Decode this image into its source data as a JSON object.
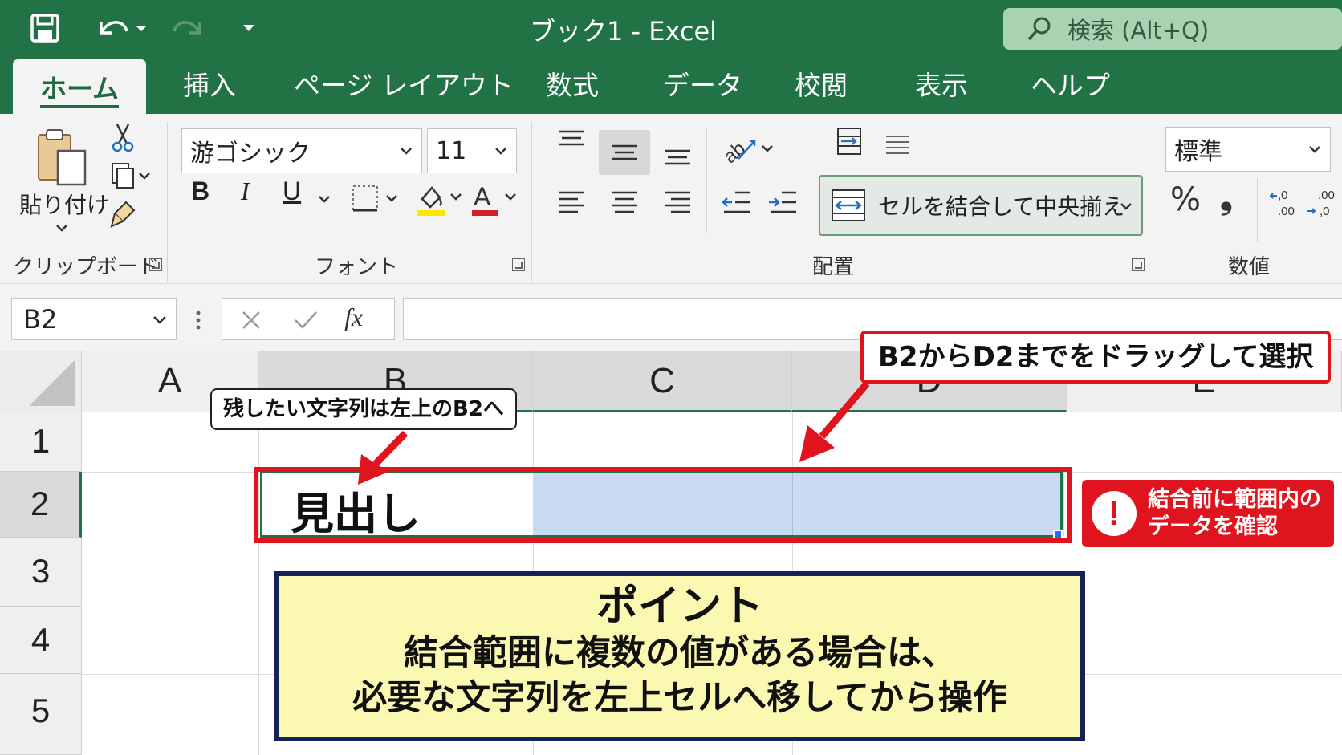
{
  "window": {
    "title": "ブック1  -  Excel",
    "search_label": "検索 (Alt+Q)"
  },
  "tabs": [
    "ホーム",
    "挿入",
    "ページ レイアウト",
    "数式",
    "データ",
    "校閲",
    "表示",
    "ヘルプ"
  ],
  "active_tab": "ホーム",
  "ribbon": {
    "clipboard": {
      "paste_label": "貼り付け",
      "group_label": "クリップボード"
    },
    "font": {
      "font_name": "游ゴシック",
      "font_size": "11",
      "group_label": "フォント",
      "bold": "B",
      "italic": "I",
      "underline": "U",
      "font_color_glyph": "A",
      "highlight_color": "#ffe600",
      "font_color": "#d4202a"
    },
    "alignment": {
      "merge_label": "セルを結合して中央揃え",
      "group_label": "配置"
    },
    "number": {
      "format": "標準",
      "percent": "%",
      "comma": "❟",
      "group_label": "数値"
    }
  },
  "formula_bar": {
    "name_box": "B2",
    "fx": "fx",
    "content": ""
  },
  "sheet": {
    "columns": [
      "A",
      "B",
      "C",
      "D",
      "E"
    ],
    "rows": [
      "1",
      "2",
      "3",
      "4",
      "5"
    ],
    "cell_b2": "見出し",
    "selection": "B2:D2",
    "selection_color": "#c9daf3"
  },
  "annotations": {
    "callout_b2": "残したい文字列は左上のB2へ",
    "callout_drag": "B2からD2までをドラッグして選択",
    "warning": [
      "結合前に範囲内の",
      "データを確認"
    ],
    "point_title": "ポイント",
    "point_lines": [
      "結合範囲に複数の値がある場合は、",
      "必要な文字列を左上セルへ移してから操作"
    ],
    "accent_red": "#e0141e",
    "point_bg": "#fbf8b2",
    "point_border": "#13235a"
  }
}
